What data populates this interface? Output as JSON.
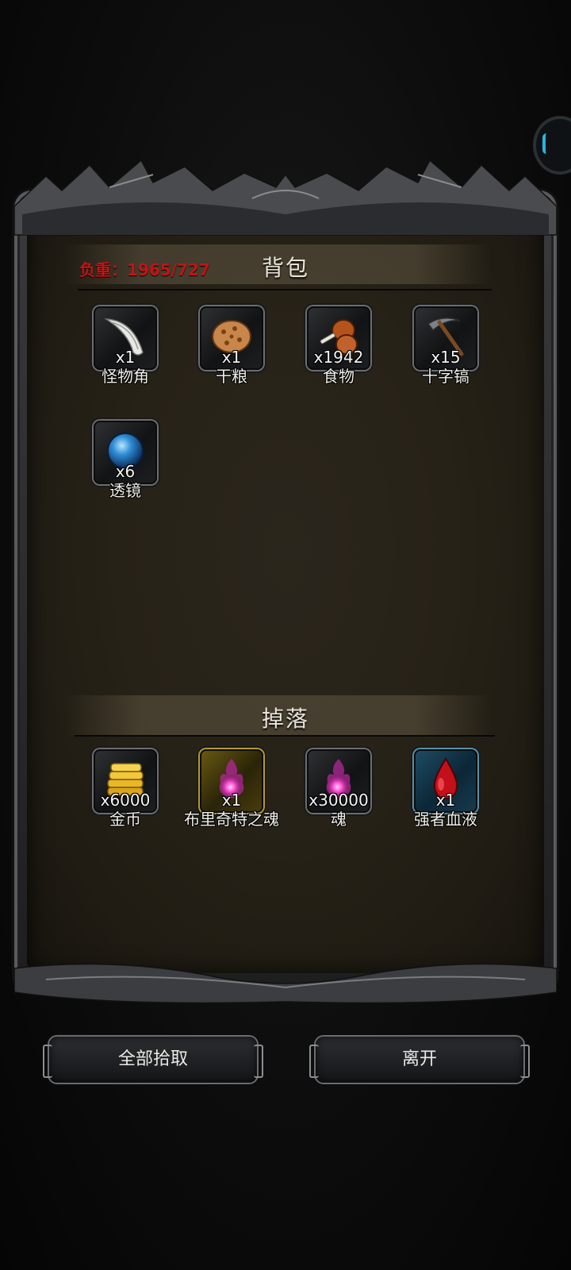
{
  "inventory": {
    "title": "背包",
    "weight_text": "负重：1965/727",
    "items": [
      {
        "name": "怪物角",
        "qty": "x1",
        "icon": "monster-horn-icon"
      },
      {
        "name": "干粮",
        "qty": "x1",
        "icon": "dry-food-icon"
      },
      {
        "name": "食物",
        "qty": "x1942",
        "icon": "roast-meat-icon"
      },
      {
        "name": "十字镐",
        "qty": "x15",
        "icon": "pickaxe-icon"
      },
      {
        "name": "透镜",
        "qty": "x6",
        "icon": "blue-orb-icon"
      }
    ]
  },
  "drops": {
    "title": "掉落",
    "items": [
      {
        "name": "金币",
        "qty": "x6000",
        "icon": "gold-coins-icon"
      },
      {
        "name": "布里奇特之魂",
        "qty": "x1",
        "icon": "soul-orb-icon"
      },
      {
        "name": "魂",
        "qty": "x30000",
        "icon": "soul-orb-icon"
      },
      {
        "name": "强者血液",
        "qty": "x1",
        "icon": "blood-drop-icon"
      }
    ]
  },
  "buttons": {
    "pick_all": "全部拾取",
    "leave": "离开"
  },
  "colors": {
    "weight": "#c01515",
    "panel": "#272217",
    "accent_blue": "#29b6d8"
  }
}
